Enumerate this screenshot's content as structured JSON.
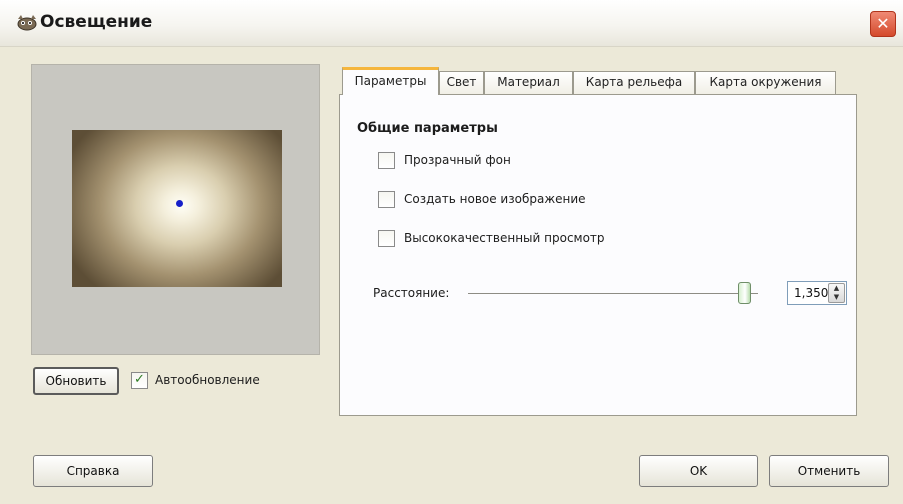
{
  "window": {
    "title": "Освещение",
    "close_glyph": "✕",
    "icon": "gimp-wilber-icon"
  },
  "preview": {
    "update_button": "Обновить",
    "auto_update_label": "Автообновление",
    "auto_update_checked": true
  },
  "tabs": [
    {
      "label": "Параметры",
      "active": true
    },
    {
      "label": "Свет",
      "active": false
    },
    {
      "label": "Материал",
      "active": false
    },
    {
      "label": "Карта рельефа",
      "active": false
    },
    {
      "label": "Карта окружения",
      "active": false
    }
  ],
  "options": {
    "section_title": "Общие параметры",
    "checkboxes": [
      {
        "label": "Прозрачный фон",
        "checked": false
      },
      {
        "label": "Создать новое изображение",
        "checked": false
      },
      {
        "label": "Высококачественный просмотр",
        "checked": false
      }
    ],
    "distance": {
      "label": "Расстояние:",
      "value": "1,350"
    }
  },
  "buttons": {
    "help": "Справка",
    "ok": "OK",
    "cancel": "Отменить"
  },
  "colors": {
    "active_tab_accent": "#f5b63d",
    "light_marker": "#1720c9"
  }
}
